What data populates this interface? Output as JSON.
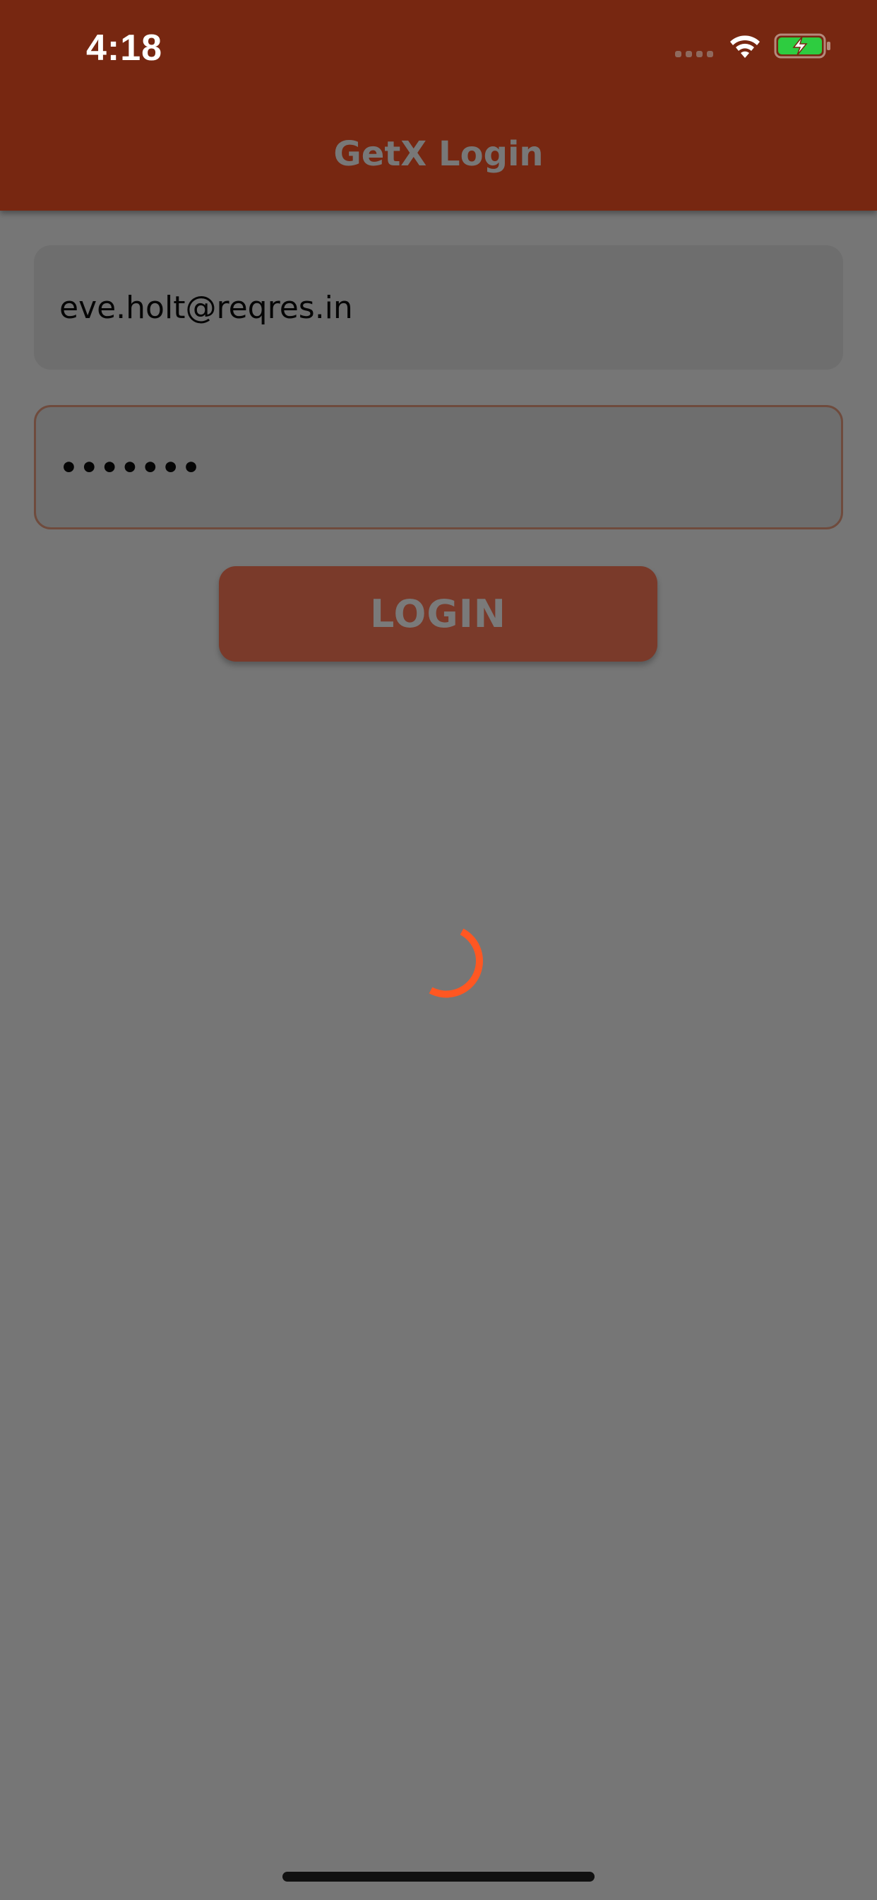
{
  "status_bar": {
    "time": "4:18",
    "wifi_icon": "wifi-icon",
    "battery_icon": "battery-charging-icon",
    "signal_icon": "cellular-signal-icon"
  },
  "app_bar": {
    "title": "GetX Login"
  },
  "form": {
    "email_value": "eve.holt@reqres.in",
    "password_value": "•••••••",
    "login_label": "LOGIN"
  },
  "loading": {
    "spinner_icon": "loading-spinner-icon"
  },
  "colors": {
    "app_bar": "#772711",
    "overlay_background": "#767676",
    "spinner": "#ff5722",
    "button": "#7a3a2a",
    "battery_fill": "#2ecc40"
  }
}
